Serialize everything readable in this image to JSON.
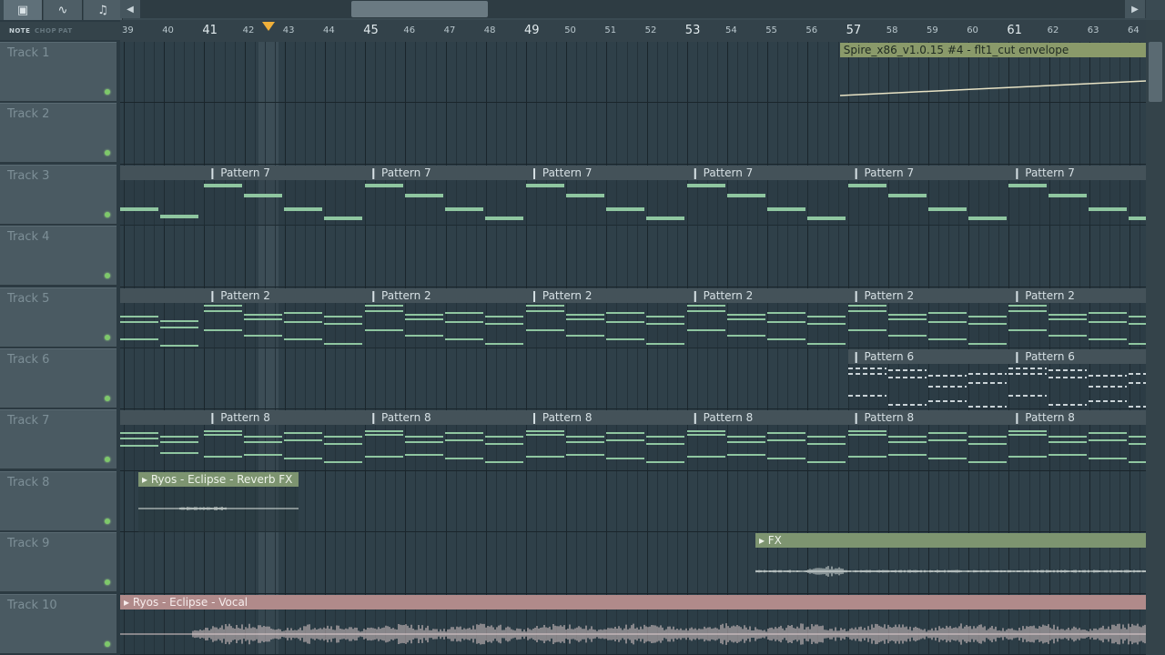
{
  "toolbar": {
    "buttons": [
      {
        "icon": "playlist-icon",
        "glyph": "▣"
      },
      {
        "icon": "automation-icon",
        "glyph": "∿"
      },
      {
        "icon": "note-icon",
        "glyph": "♫"
      }
    ],
    "scroll_left": "◀",
    "scroll_right": "▶"
  },
  "modes": {
    "note": "NOTE",
    "chop": "CHOP",
    "pat": "PAT"
  },
  "ruler": {
    "bars": [
      "39",
      "40",
      "41",
      "42",
      "43",
      "44",
      "45",
      "46",
      "47",
      "48",
      "49",
      "50",
      "51",
      "52",
      "53",
      "54",
      "55",
      "56",
      "57",
      "58",
      "59",
      "60",
      "61",
      "62",
      "63",
      "64"
    ],
    "big_bars": [
      "41",
      "45",
      "49",
      "53",
      "57",
      "61"
    ]
  },
  "tracks": [
    {
      "name": "Track 1"
    },
    {
      "name": "Track 2"
    },
    {
      "name": "Track 3"
    },
    {
      "name": "Track 4"
    },
    {
      "name": "Track 5"
    },
    {
      "name": "Track 6"
    },
    {
      "name": "Track 7"
    },
    {
      "name": "Track 8"
    },
    {
      "name": "Track 9"
    },
    {
      "name": "Track 10"
    }
  ],
  "clips": {
    "automation": "Spire_x86_v1.0.15 #4 - flt1_cut envelope",
    "pattern7": "Pattern 7",
    "pattern2": "Pattern 2",
    "pattern6": "Pattern 6",
    "pattern8": "Pattern 8",
    "reverb": "Ryos - Eclipse - Reverb FX",
    "fx": "FX",
    "vocal": "Ryos - Eclipse - Vocal"
  },
  "colors": {
    "automation_clip": "#8a9a6a",
    "audio_clip_green": "#7d9470",
    "vocal_clip": "#b08a8a",
    "note_green": "#8fc6a0",
    "playhead": "#f0b03a",
    "led": "#7ec86a"
  }
}
